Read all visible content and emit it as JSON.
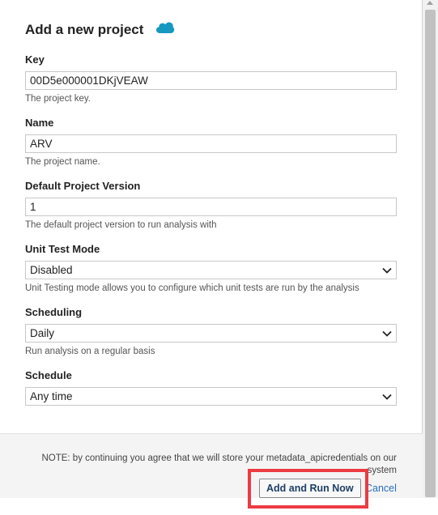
{
  "dialog": {
    "title": "Add a new project",
    "icon": "salesforce-cloud-icon"
  },
  "fields": {
    "key": {
      "label": "Key",
      "value": "00D5e000001DKjVEAW",
      "help": "The project key."
    },
    "name": {
      "label": "Name",
      "value": "ARV",
      "help": "The project name."
    },
    "version": {
      "label": "Default Project Version",
      "value": "1",
      "help": "The default project version to run analysis with"
    },
    "unit_test_mode": {
      "label": "Unit Test Mode",
      "selected": "Disabled",
      "help": "Unit Testing mode allows you to configure which unit tests are run by the analysis"
    },
    "scheduling": {
      "label": "Scheduling",
      "selected": "Daily",
      "help": "Run analysis on a regular basis"
    },
    "schedule": {
      "label": "Schedule",
      "selected": "Any time"
    }
  },
  "footer": {
    "note": "NOTE: by continuing you agree that we will store your metadata_apicredentials on our system",
    "add_run_label": "Add and Run Now",
    "cancel_label": "Cancel"
  },
  "colors": {
    "accent": "#2a6ebb",
    "highlight": "#ec3b43",
    "cloud": "#1798c1"
  }
}
